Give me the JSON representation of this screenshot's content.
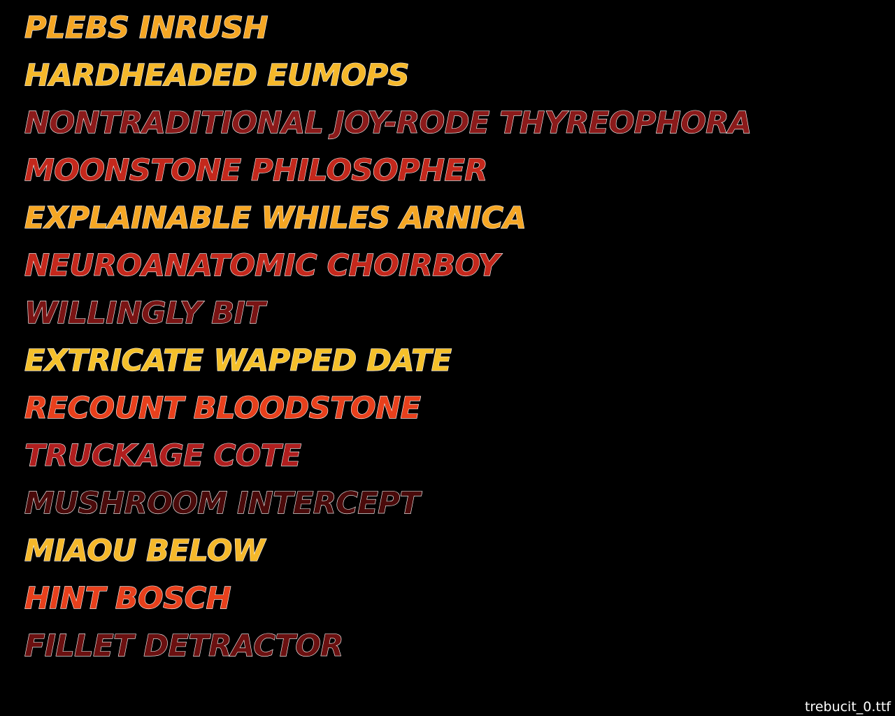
{
  "lines": [
    {
      "text": "PLEBS INRUSH",
      "color": "#f5a623"
    },
    {
      "text": "HARDHEADED EUMOPS",
      "color": "#f5b82a"
    },
    {
      "text": "NONTRADITIONAL JOY-RODE THYREOPHORA",
      "color": "#8b1a1a"
    },
    {
      "text": "MOONSTONE PHILOSOPHER",
      "color": "#c4281c"
    },
    {
      "text": "EXPLAINABLE WHILES ARNICA",
      "color": "#f5a623"
    },
    {
      "text": "NEUROANATOMIC CHOIRBOY",
      "color": "#c4281c"
    },
    {
      "text": "WILLINGLY BIT",
      "color": "#7a1414"
    },
    {
      "text": "EXTRICATE WAPPED DATE",
      "color": "#f5c02a"
    },
    {
      "text": "RECOUNT BLOODSTONE",
      "color": "#e8401c"
    },
    {
      "text": "TRUCKAGE COTE",
      "color": "#b01e1e"
    },
    {
      "text": "MUSHROOM INTERCEPT",
      "color": "#4a0a0a"
    },
    {
      "text": "MIAOU BELOW",
      "color": "#f5b82a"
    },
    {
      "text": "HINT BOSCH",
      "color": "#e8401c"
    },
    {
      "text": "FILLET DETRACTOR",
      "color": "#6b1010"
    }
  ],
  "footer": {
    "label": "trebucit_0.ttf"
  }
}
